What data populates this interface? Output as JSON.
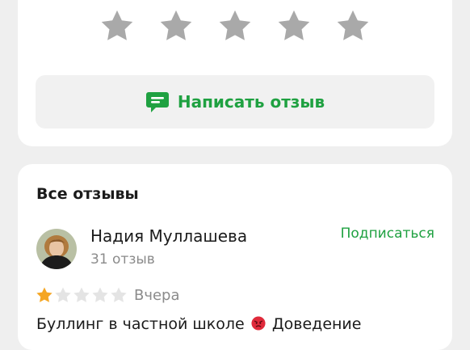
{
  "rating_prompt": {
    "stars": [
      "star-1",
      "star-2",
      "star-3",
      "star-4",
      "star-5"
    ]
  },
  "write_review": {
    "label": "Написать отзыв",
    "icon": "message-icon"
  },
  "reviews": {
    "title": "Все отзывы",
    "items": [
      {
        "author": "Надия Муллашева",
        "author_meta": "31 отзыв",
        "subscribe_label": "Подписаться",
        "rating": 1,
        "rating_max": 5,
        "date": "Вчера",
        "text_before": "Буллинг в частной школе",
        "text_after": "Доведение",
        "emoji": "angry-face"
      }
    ]
  },
  "colors": {
    "accent": "#1fa141",
    "star_empty": "#a9a9a9",
    "star_filled": "#f5a623",
    "background": "#efefef",
    "card": "#ffffff",
    "button_bg": "#f1f1f1",
    "muted": "#8b8b8b"
  }
}
